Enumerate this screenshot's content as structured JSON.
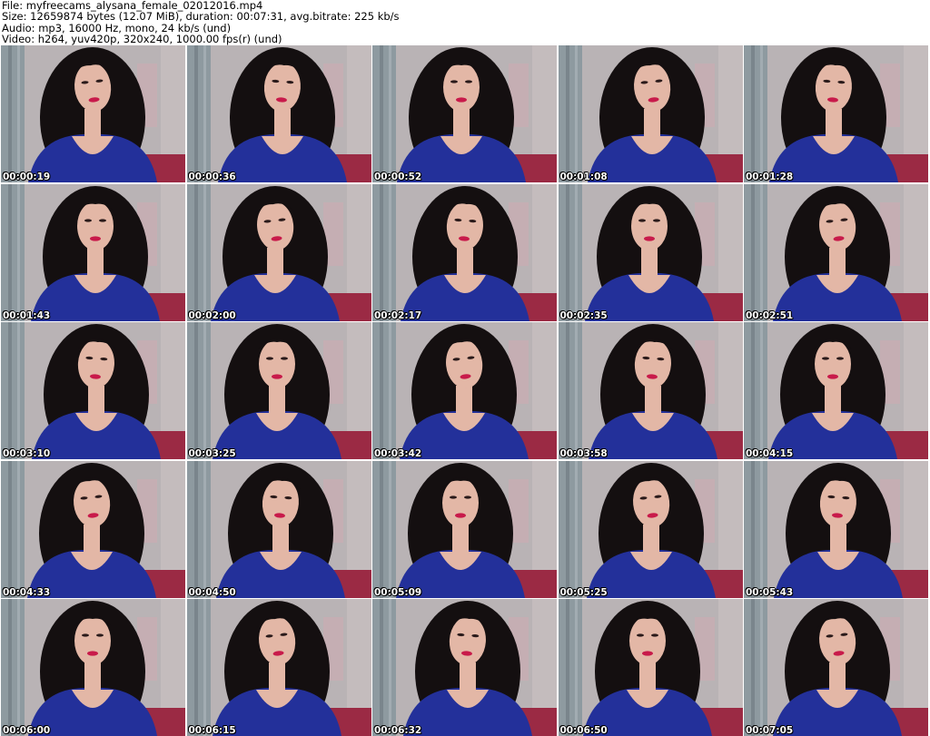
{
  "header": {
    "file_line": "File: myfreecams_alysana_female_02012016.mp4",
    "size_line": "Size: 12659874 bytes (12.07 MiB), duration: 00:07:31, avg.bitrate: 225 kb/s",
    "audio_line": "Audio: mp3, 16000 Hz, mono, 24 kb/s (und)",
    "video_line": "Video: h264, yuv420p, 320x240, 1000.00 fps(r) (und)"
  },
  "thumbnails": [
    {
      "timestamp": "00:00:19"
    },
    {
      "timestamp": "00:00:36"
    },
    {
      "timestamp": "00:00:52"
    },
    {
      "timestamp": "00:01:08"
    },
    {
      "timestamp": "00:01:28"
    },
    {
      "timestamp": "00:01:43"
    },
    {
      "timestamp": "00:02:00"
    },
    {
      "timestamp": "00:02:17"
    },
    {
      "timestamp": "00:02:35"
    },
    {
      "timestamp": "00:02:51"
    },
    {
      "timestamp": "00:03:10"
    },
    {
      "timestamp": "00:03:25"
    },
    {
      "timestamp": "00:03:42"
    },
    {
      "timestamp": "00:03:58"
    },
    {
      "timestamp": "00:04:15"
    },
    {
      "timestamp": "00:04:33"
    },
    {
      "timestamp": "00:04:50"
    },
    {
      "timestamp": "00:05:09"
    },
    {
      "timestamp": "00:05:25"
    },
    {
      "timestamp": "00:05:43"
    },
    {
      "timestamp": "00:06:00"
    },
    {
      "timestamp": "00:06:15"
    },
    {
      "timestamp": "00:06:32"
    },
    {
      "timestamp": "00:06:50"
    },
    {
      "timestamp": "00:07:05"
    }
  ],
  "colors": {
    "background": "#ffffff",
    "wall": "#b9b3b5",
    "curtain": "#8e9aa0",
    "hair": "#140f10",
    "skin": "#e3b7a6",
    "dress": "#23309a",
    "lips": "#c81a4a",
    "timestamp_text": "#ffffff"
  }
}
